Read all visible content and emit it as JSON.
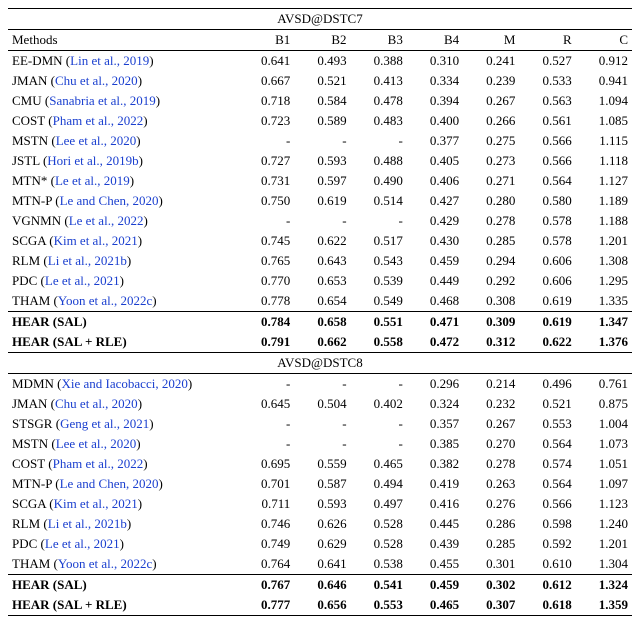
{
  "sections": [
    {
      "title": "AVSD@DSTC7",
      "header": [
        "Methods",
        "B1",
        "B2",
        "B3",
        "B4",
        "M",
        "R",
        "C"
      ],
      "rows": [
        {
          "name": "EE-DMN",
          "cite": "Lin et al., 2019",
          "v": [
            "0.641",
            "0.493",
            "0.388",
            "0.310",
            "0.241",
            "0.527",
            "0.912"
          ]
        },
        {
          "name": "JMAN",
          "cite": "Chu et al., 2020",
          "v": [
            "0.667",
            "0.521",
            "0.413",
            "0.334",
            "0.239",
            "0.533",
            "0.941"
          ]
        },
        {
          "name": "CMU",
          "cite": "Sanabria et al., 2019",
          "v": [
            "0.718",
            "0.584",
            "0.478",
            "0.394",
            "0.267",
            "0.563",
            "1.094"
          ]
        },
        {
          "name": "COST",
          "cite": "Pham et al., 2022",
          "v": [
            "0.723",
            "0.589",
            "0.483",
            "0.400",
            "0.266",
            "0.561",
            "1.085"
          ]
        },
        {
          "name": "MSTN",
          "cite": "Lee et al., 2020",
          "v": [
            "-",
            "-",
            "-",
            "0.377",
            "0.275",
            "0.566",
            "1.115"
          ]
        },
        {
          "name": "JSTL",
          "cite": "Hori et al., 2019b",
          "v": [
            "0.727",
            "0.593",
            "0.488",
            "0.405",
            "0.273",
            "0.566",
            "1.118"
          ]
        },
        {
          "name": "MTN*",
          "cite": "Le et al., 2019",
          "v": [
            "0.731",
            "0.597",
            "0.490",
            "0.406",
            "0.271",
            "0.564",
            "1.127"
          ]
        },
        {
          "name": "MTN-P",
          "cite": "Le and Chen, 2020",
          "v": [
            "0.750",
            "0.619",
            "0.514",
            "0.427",
            "0.280",
            "0.580",
            "1.189"
          ]
        },
        {
          "name": "VGNMN",
          "cite": "Le et al., 2022",
          "v": [
            "-",
            "-",
            "-",
            "0.429",
            "0.278",
            "0.578",
            "1.188"
          ]
        },
        {
          "name": "SCGA",
          "cite": "Kim et al., 2021",
          "v": [
            "0.745",
            "0.622",
            "0.517",
            "0.430",
            "0.285",
            "0.578",
            "1.201"
          ]
        },
        {
          "name": "RLM",
          "cite": "Li et al., 2021b",
          "v": [
            "0.765",
            "0.643",
            "0.543",
            "0.459",
            "0.294",
            "0.606",
            "1.308"
          ]
        },
        {
          "name": "PDC",
          "cite": "Le et al., 2021",
          "v": [
            "0.770",
            "0.653",
            "0.539",
            "0.449",
            "0.292",
            "0.606",
            "1.295"
          ]
        },
        {
          "name": "THAM",
          "cite": "Yoon et al., 2022c",
          "v": [
            "0.778",
            "0.654",
            "0.549",
            "0.468",
            "0.308",
            "0.619",
            "1.335"
          ]
        }
      ],
      "bold_rows": [
        {
          "name": "HEAR (SAL)",
          "v": [
            "0.784",
            "0.658",
            "0.551",
            "0.471",
            "0.309",
            "0.619",
            "1.347"
          ]
        },
        {
          "name": "HEAR (SAL + RLE)",
          "v": [
            "0.791",
            "0.662",
            "0.558",
            "0.472",
            "0.312",
            "0.622",
            "1.376"
          ]
        }
      ]
    },
    {
      "title": "AVSD@DSTC8",
      "rows": [
        {
          "name": "MDMN",
          "cite": "Xie and Iacobacci, 2020",
          "v": [
            "-",
            "-",
            "-",
            "0.296",
            "0.214",
            "0.496",
            "0.761"
          ]
        },
        {
          "name": "JMAN",
          "cite": "Chu et al., 2020",
          "v": [
            "0.645",
            "0.504",
            "0.402",
            "0.324",
            "0.232",
            "0.521",
            "0.875"
          ]
        },
        {
          "name": "STSGR",
          "cite": "Geng et al., 2021",
          "v": [
            "-",
            "-",
            "-",
            "0.357",
            "0.267",
            "0.553",
            "1.004"
          ]
        },
        {
          "name": "MSTN",
          "cite": "Lee et al., 2020",
          "v": [
            "-",
            "-",
            "-",
            "0.385",
            "0.270",
            "0.564",
            "1.073"
          ]
        },
        {
          "name": "COST",
          "cite": "Pham et al., 2022",
          "v": [
            "0.695",
            "0.559",
            "0.465",
            "0.382",
            "0.278",
            "0.574",
            "1.051"
          ]
        },
        {
          "name": "MTN-P",
          "cite": "Le and Chen, 2020",
          "v": [
            "0.701",
            "0.587",
            "0.494",
            "0.419",
            "0.263",
            "0.564",
            "1.097"
          ]
        },
        {
          "name": "SCGA",
          "cite": "Kim et al., 2021",
          "v": [
            "0.711",
            "0.593",
            "0.497",
            "0.416",
            "0.276",
            "0.566",
            "1.123"
          ]
        },
        {
          "name": "RLM",
          "cite": "Li et al., 2021b",
          "v": [
            "0.746",
            "0.626",
            "0.528",
            "0.445",
            "0.286",
            "0.598",
            "1.240"
          ]
        },
        {
          "name": "PDC",
          "cite": "Le et al., 2021",
          "v": [
            "0.749",
            "0.629",
            "0.528",
            "0.439",
            "0.285",
            "0.592",
            "1.201"
          ]
        },
        {
          "name": "THAM",
          "cite": "Yoon et al., 2022c",
          "v": [
            "0.764",
            "0.641",
            "0.538",
            "0.455",
            "0.301",
            "0.610",
            "1.304"
          ]
        }
      ],
      "bold_rows": [
        {
          "name": "HEAR (SAL)",
          "v": [
            "0.767",
            "0.646",
            "0.541",
            "0.459",
            "0.302",
            "0.612",
            "1.324"
          ]
        },
        {
          "name": "HEAR (SAL + RLE)",
          "v": [
            "0.777",
            "0.656",
            "0.553",
            "0.465",
            "0.307",
            "0.618",
            "1.359"
          ]
        }
      ]
    }
  ]
}
